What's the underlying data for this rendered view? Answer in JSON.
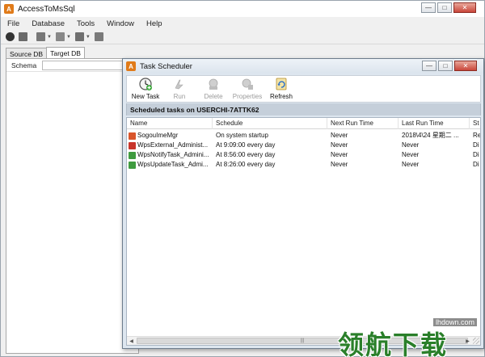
{
  "main_window": {
    "title": "AccessToMsSql",
    "menu": [
      "File",
      "Database",
      "Tools",
      "Window",
      "Help"
    ],
    "tabs": [
      "Source DB",
      "Target DB"
    ],
    "active_tab": "Target DB",
    "schema_label": "Schema"
  },
  "task_scheduler": {
    "title": "Task Scheduler",
    "toolbar": {
      "new_task": "New Task",
      "run": "Run",
      "delete": "Delete",
      "properties": "Properties",
      "refresh": "Refresh"
    },
    "banner": "Scheduled tasks on USERCHI-7ATTK62",
    "columns": [
      "Name",
      "Schedule",
      "Next Run Time",
      "Last Run Time",
      "St"
    ],
    "tasks": [
      {
        "name": "SogouImeMgr",
        "schedule": "On system startup",
        "next_run": "Never",
        "last_run": "2018\\4\\24 星期二 ...",
        "status": "Re",
        "icon_color": "#d9552b"
      },
      {
        "name": "WpsExternal_Administ...",
        "schedule": "At 9:09:00 every day",
        "next_run": "Never",
        "last_run": "Never",
        "status": "Di",
        "icon_color": "#c8352b"
      },
      {
        "name": "WpsNotifyTask_Admini...",
        "schedule": "At 8:56:00 every day",
        "next_run": "Never",
        "last_run": "Never",
        "status": "Di",
        "icon_color": "#3f9b3f"
      },
      {
        "name": "WpsUpdateTask_Admi...",
        "schedule": "At 8:26:00 every day",
        "next_run": "Never",
        "last_run": "Never",
        "status": "Di",
        "icon_color": "#3f9b3f"
      }
    ]
  },
  "watermark": {
    "url": "lhdown.com",
    "text": "领航下载"
  },
  "colors": {
    "accent": "#e07b1a",
    "banner": "#c5cfda",
    "watermark_green": "#2a7f2a"
  }
}
